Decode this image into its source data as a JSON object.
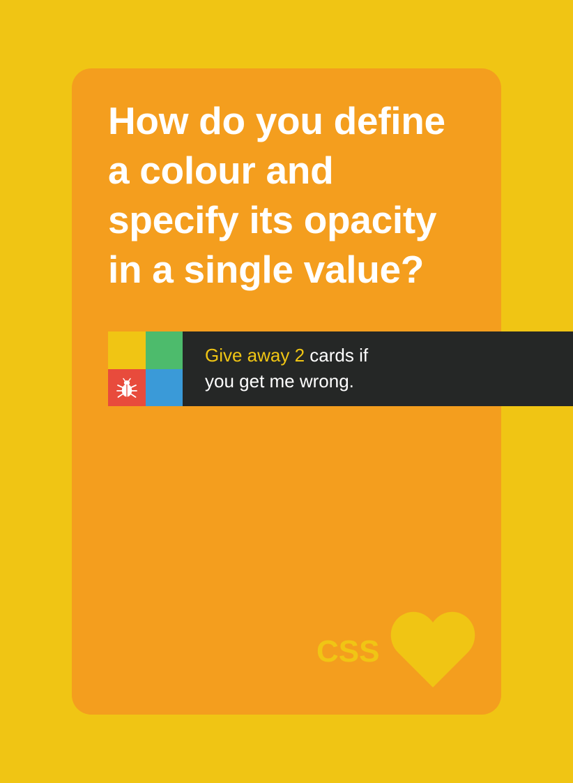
{
  "card": {
    "question_lines": [
      "How do you define",
      "a colour and",
      "specify its opacity",
      "in a single value?"
    ],
    "penalty": {
      "highlight": "Give away 2",
      "rest_line1": " cards if",
      "line2": "you get me wrong."
    },
    "brand": "CSS",
    "icons": {
      "bug": "bug-icon",
      "heart": "heart-icon"
    },
    "colors": {
      "page_background": "#F0C514",
      "card_background": "#F49E1E",
      "question_text": "#FFFFFF",
      "penalty_bar": "#252726",
      "highlight": "#F0C514",
      "tile_yellow": "#F0C514",
      "tile_green": "#4DBB6C",
      "tile_red": "#E84B3C",
      "tile_blue": "#3A9AD8"
    }
  }
}
